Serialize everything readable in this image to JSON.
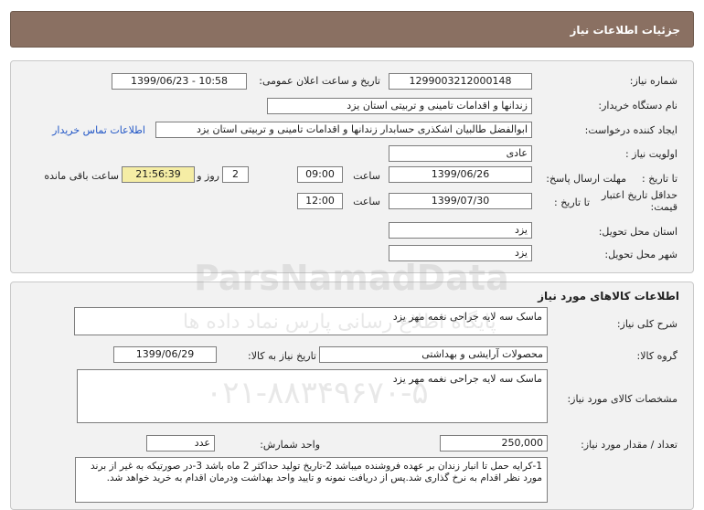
{
  "header": {
    "title": "جزئیات اطلاعات نیاز"
  },
  "info": {
    "need_number_label": "شماره نیاز:",
    "need_number": "1299003212000148",
    "announce_label": "تاریخ و ساعت اعلان عمومی:",
    "announce_value": "1399/06/23 - 10:58",
    "buyer_org_label": "نام دستگاه خریدار:",
    "buyer_org": "زندانها و اقدامات تامینی و تربیتی استان یزد",
    "creator_label": "ایجاد کننده درخواست:",
    "creator": "ابوالفضل  طالبیان اشکذری حسابدار زندانها و اقدامات تامینی و تربیتی استان یزد",
    "contact_link": "اطلاعات تماس خریدار",
    "priority_label": "اولویت نیاز :",
    "priority": "عادی",
    "deadline_label": "مهلت ارسال پاسخ:",
    "to_date_label": "تا تاریخ :",
    "deadline_date": "1399/06/26",
    "time_label": "ساعت",
    "deadline_time": "09:00",
    "days": "2",
    "days_label": "روز و",
    "remaining_time": "21:56:39",
    "remaining_label": "ساعت باقی مانده",
    "validity_label_1": "حداقل تاریخ اعتبار",
    "validity_label_2": "قیمت:",
    "validity_date": "1399/07/30",
    "validity_time": "12:00",
    "province_label": "استان محل تحویل:",
    "province": "یزد",
    "city_label": "شهر محل تحویل:",
    "city": "یزد"
  },
  "goods": {
    "section_title": "اطلاعات کالاهای مورد نیاز",
    "summary_label": "شرح کلی نیاز:",
    "summary": "ماسک سه لایه جراحی نغمه مهر یزد",
    "group_label": "گروه کالا:",
    "group": "محصولات آرایشی و بهداشتی",
    "need_date_label": "تاریخ نیاز به کالا:",
    "need_date": "1399/06/29",
    "specs_label": "مشخصات کالای مورد نیاز:",
    "specs": "ماسک سه لایه جراحی نغمه مهر یزد",
    "qty_label": "تعداد / مقدار مورد نیاز:",
    "qty": "250,000",
    "unit_label": "واحد شمارش:",
    "unit": "عدد",
    "notes": "1-کرایه حمل تا انبار زندان بر عهده فروشنده میباشد 2-تاریخ تولید حداکثر 2 ماه باشد 3-در صورتیکه به غیر از برند مورد نظر اقدام به نرخ گذاری شد.پس از دریافت نمونه و تایید واحد بهداشت ودرمان اقدام به خرید خواهد شد."
  },
  "watermark": {
    "line1": "ParsNamadData",
    "line2": "پایگاه اطلاع رسانی پارس نماد داده ها",
    "line3": "۰۲۱-۸۸۳۴۹۶۷۰-۵"
  }
}
